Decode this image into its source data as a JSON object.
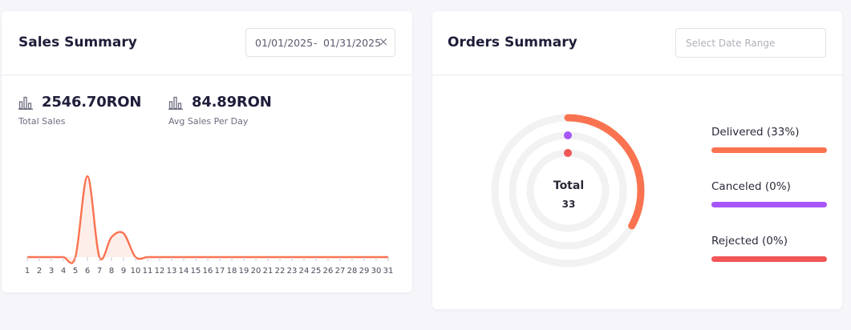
{
  "sales": {
    "title": "Sales Summary",
    "date_from": "01/01/2025",
    "date_separator": "-",
    "date_to": "01/31/2025",
    "clear_icon": "×",
    "total_sales_value": "2546.70RON",
    "total_sales_label": "Total Sales",
    "avg_sales_value": "84.89RON",
    "avg_sales_label": "Avg Sales Per Day"
  },
  "orders": {
    "title": "Orders Summary",
    "date_placeholder": "Select Date Range",
    "total_label": "Total",
    "total_value": "33",
    "legend": [
      {
        "label": "Delivered (33%)",
        "color": "#fa7350"
      },
      {
        "label": "Canceled (0%)",
        "color": "#a855f7"
      },
      {
        "label": "Rejected (0%)",
        "color": "#f25656"
      }
    ]
  },
  "chart_data": [
    {
      "type": "area",
      "title": "",
      "xlabel": "",
      "ylabel": "",
      "x": [
        1,
        2,
        3,
        4,
        5,
        6,
        7,
        8,
        9,
        10,
        11,
        12,
        13,
        14,
        15,
        16,
        17,
        18,
        19,
        20,
        21,
        22,
        23,
        24,
        25,
        26,
        27,
        28,
        29,
        30,
        31
      ],
      "x_tick_labels": [
        "1",
        "2",
        "3",
        "4",
        "5",
        "6",
        "7",
        "8",
        "9",
        "10",
        "11",
        "12",
        "13",
        "14",
        "15",
        "16",
        "17",
        "18",
        "19",
        "20",
        "21",
        "22",
        "23",
        "24",
        "25",
        "26",
        "27",
        "28",
        "29",
        "30",
        "31"
      ],
      "series": [
        {
          "values": [
            0,
            0,
            0,
            0,
            0,
            1700,
            0,
            420,
            500,
            0,
            0,
            0,
            0,
            0,
            0,
            0,
            0,
            0,
            0,
            0,
            0,
            0,
            0,
            0,
            0,
            0,
            0,
            0,
            0,
            0,
            0
          ],
          "color": "#fa7350"
        }
      ],
      "grid": false,
      "legend": "none"
    },
    {
      "type": "radialBar",
      "title": "",
      "center_label": "Total",
      "center_value": "33",
      "categories": [
        "Delivered",
        "Canceled",
        "Rejected"
      ],
      "values": [
        33,
        0,
        0
      ],
      "value_unit": "percent",
      "colors": [
        "#fa7350",
        "#a855f7",
        "#f25656"
      ],
      "track_color": "#f2f2f2",
      "legend": "right"
    }
  ]
}
